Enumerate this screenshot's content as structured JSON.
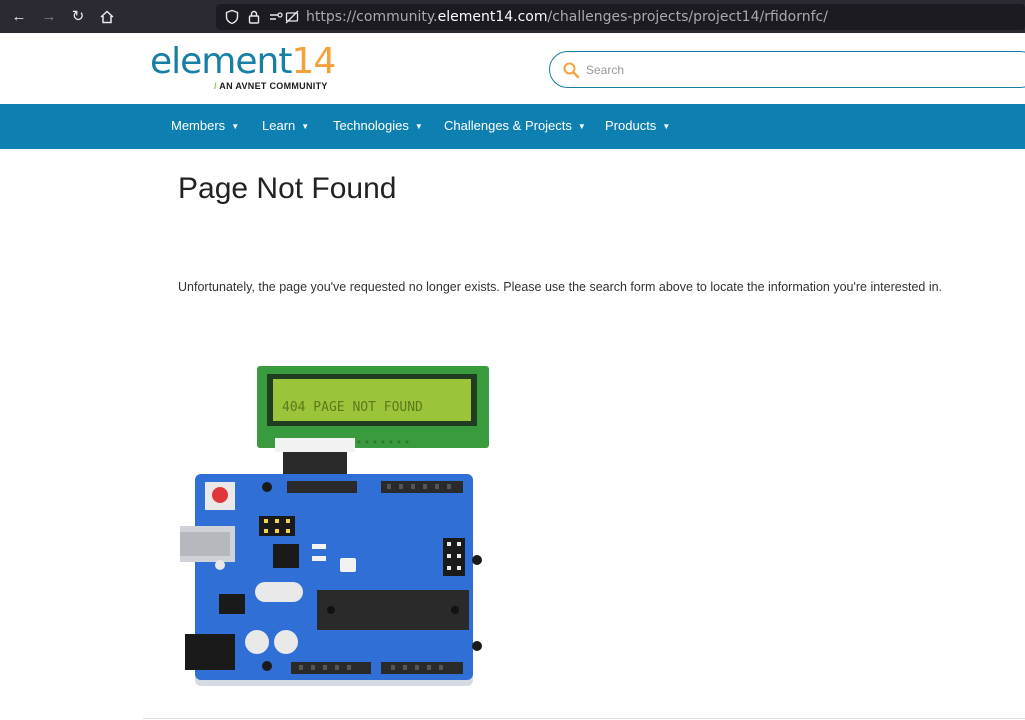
{
  "browser": {
    "url_prefix": "https://community.",
    "url_host": "element14.com",
    "url_path": "/challenges-projects/project14/rfidornfc/"
  },
  "header": {
    "logo_text": "element",
    "logo_number": "14",
    "logo_tagline_slash": "/",
    "logo_tagline": "AN AVNET COMMUNITY",
    "search_placeholder": "Search"
  },
  "nav": {
    "items": [
      {
        "label": "Members"
      },
      {
        "label": "Learn"
      },
      {
        "label": "Technologies"
      },
      {
        "label": "Challenges & Projects"
      },
      {
        "label": "Products"
      }
    ]
  },
  "main": {
    "title": "Page Not Found",
    "message": "Unfortunately, the page you've requested no longer exists. Please use the search form above to locate the information you're interested in.",
    "lcd_text": "404 PAGE NOT FOUND"
  },
  "colors": {
    "brand_blue": "#0d7fb0",
    "logo_orange": "#f2a13b",
    "board_blue": "#2f6fd6",
    "lcd_green": "#9cc43a"
  },
  "icons": [
    "back-icon",
    "forward-icon",
    "reload-icon",
    "home-icon",
    "shield-icon",
    "lock-icon",
    "permissions-icon",
    "search-icon",
    "caret-down-icon"
  ]
}
